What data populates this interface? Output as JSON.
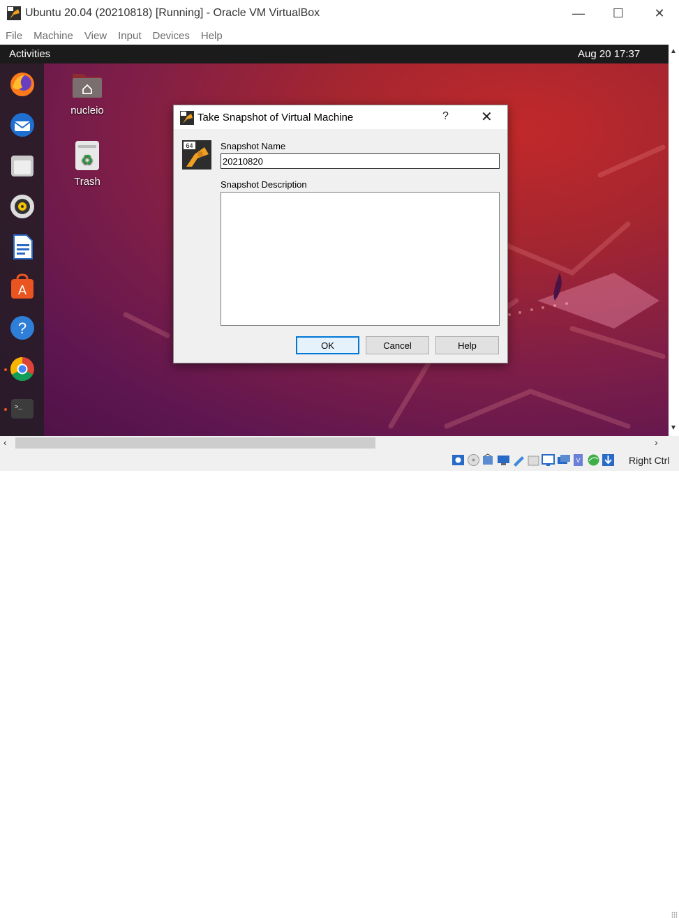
{
  "window": {
    "title": "Ubuntu 20.04 (20210818) [Running] - Oracle VM VirtualBox",
    "minimize": "—",
    "maximize": "☐",
    "close": "✕"
  },
  "menu": [
    "File",
    "Machine",
    "View",
    "Input",
    "Devices",
    "Help"
  ],
  "gnome": {
    "activities": "Activities",
    "clock": "Aug 20  17:37"
  },
  "dock": [
    "firefox-icon",
    "thunderbird-icon",
    "files-icon",
    "rhythmbox-icon",
    "libreoffice-writer-icon",
    "software-icon",
    "help-icon",
    "chrome-icon",
    "terminal-icon"
  ],
  "desktop_icons": {
    "home": "nucleio",
    "trash": "Trash"
  },
  "dialog": {
    "title": "Take Snapshot of Virtual Machine",
    "help_symbol": "?",
    "close_symbol": "✕",
    "name_label": "Snapshot Name",
    "name_value": "20210820",
    "desc_label": "Snapshot Description",
    "desc_value": "",
    "ok": "OK",
    "cancel": "Cancel",
    "help": "Help"
  },
  "status": {
    "host_key": "Right Ctrl"
  },
  "colors": {
    "accent": "#0078d7",
    "ubuntu_orange": "#e95420",
    "topbar": "#1b1b1b"
  }
}
